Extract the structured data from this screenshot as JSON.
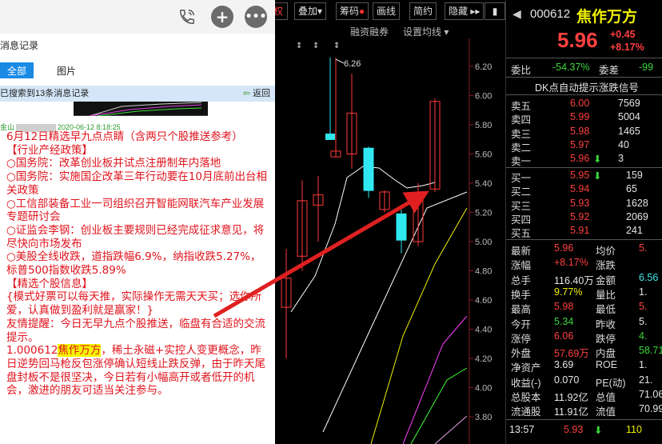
{
  "chat": {
    "history_title": "消息记录",
    "tabs": [
      "全部",
      "图片"
    ],
    "search_result": "已搜索到13条消息记录",
    "back_label": "返回",
    "meta_sender": "金山",
    "meta_time": "2020-06-12 8:18:25",
    "paragraphs": [
      "6月12日精选早九点点睛（含两只个股推送参考）",
      "【行业产经政策】",
      "○国务院：改革创业板并试点注册制年内落地",
      "○国务院：实施国企改革三年行动要在10月底前出台相关政策",
      "○工信部装备工业一司组织召开智能网联汽车产业发展专题研讨会",
      "○证监会李钢：创业板主要规则已经完成征求意见，将尽快向市场发布",
      "○美股全线收跌，道指跌幅6.9%，纳指收跌5.27%，标普500指数收跌5.89%",
      "【精选个股信息】",
      "{模式好票可以每天推，实际操作无需天天买；选你所爱，认真做到盈利就是赢家！}",
      "友情提醒：今日无早九点个股推送，临盘有合适的交流提示。"
    ],
    "stock_prefix": "1.000612",
    "stock_highlight": "焦作万方",
    "stock_rest": "，稀土永磁+实控人变更概念，昨日逆势回马枪反包涨停确认短线止跌反弹，由于昨天尾盘封板不是很坚决，今日若有小幅高开或者低开的机会，激进的朋友可适当关注参与。"
  },
  "toolbar": {
    "items": [
      "叠加",
      "筹码",
      "画线",
      "简约",
      "隐藏"
    ],
    "sub_items": [
      "融资融券",
      "设置均线"
    ]
  },
  "chart_data": {
    "type": "candlestick",
    "y_ticks": [
      "6.20",
      "6.00",
      "5.80",
      "5.60",
      "5.40",
      "5.20",
      "5.00",
      "4.80",
      "4.60",
      "4.40",
      "4.20",
      "4.00",
      "3.80"
    ],
    "ylim": [
      3.7,
      6.25
    ],
    "high_annotation": "6.26",
    "candles": [
      {
        "o": 4.55,
        "h": 4.95,
        "l": 4.2,
        "c": 4.75
      },
      {
        "o": 4.9,
        "h": 5.42,
        "l": 4.8,
        "c": 5.28
      },
      {
        "o": 5.25,
        "h": 5.45,
        "l": 5.0,
        "c": 5.32
      },
      {
        "o": 5.6,
        "h": 5.9,
        "l": 5.45,
        "c": 5.86
      },
      {
        "o": 5.62,
        "h": 6.26,
        "l": 5.58,
        "c": 5.58
      },
      {
        "o": 5.6,
        "h": 6.15,
        "l": 5.5,
        "c": 5.88
      },
      {
        "o": 5.64,
        "h": 5.65,
        "l": 5.3,
        "c": 5.35
      },
      {
        "o": 5.22,
        "h": 5.35,
        "l": 5.2,
        "c": 5.34
      },
      {
        "o": 5.19,
        "h": 5.22,
        "l": 4.92,
        "c": 5.01
      },
      {
        "o": 5.0,
        "h": 5.4,
        "l": 4.97,
        "c": 5.32
      },
      {
        "o": 5.4,
        "h": 5.5,
        "l": 4.97,
        "c": 5.4
      },
      {
        "o": 5.36,
        "h": 5.98,
        "l": 5.34,
        "c": 5.96
      }
    ],
    "ma_colors": [
      "#ffffff",
      "#f0f000",
      "#ff40ff",
      "#40ff40",
      "#e8a0e8"
    ]
  },
  "quote": {
    "code": "000612",
    "name": "焦作万方",
    "price": "5.96",
    "change": "+0.45",
    "change_pct": "+8.17%",
    "weibi_label": "委比",
    "weibi_value": "-54.37%",
    "weicha_label": "委差",
    "weicha_value": "-99",
    "dk_label": "DK点自动提示涨跌信号",
    "sells": [
      {
        "label": "卖五",
        "price": "6.00",
        "vol": "7569"
      },
      {
        "label": "卖四",
        "price": "5.99",
        "vol": "5004"
      },
      {
        "label": "卖三",
        "price": "5.98",
        "vol": "1465"
      },
      {
        "label": "卖二",
        "price": "5.97",
        "vol": "40"
      },
      {
        "label": "卖一",
        "price": "5.96",
        "vol": "3"
      }
    ],
    "buys": [
      {
        "label": "买一",
        "price": "5.95",
        "vol": "159"
      },
      {
        "label": "买二",
        "price": "5.94",
        "vol": "65"
      },
      {
        "label": "买三",
        "price": "5.93",
        "vol": "1628"
      },
      {
        "label": "买四",
        "price": "5.92",
        "vol": "2069"
      },
      {
        "label": "买五",
        "price": "5.91",
        "vol": "241"
      }
    ],
    "stats": [
      {
        "l1": "最新",
        "v1": "5.96",
        "c1": "red",
        "l2": "均价",
        "v2": "5.",
        "c2": "red"
      },
      {
        "l1": "涨幅",
        "v1": "+8.17%",
        "c1": "red",
        "l2": "涨跌",
        "v2": "",
        "c2": "red"
      },
      {
        "l1": "总手",
        "v1": "116.40万",
        "c1": "wht",
        "l2": "金额",
        "v2": "6.56",
        "c2": "cyan"
      },
      {
        "l1": "换手",
        "v1": "9.77%",
        "c1": "yel",
        "l2": "量比",
        "v2": "1.",
        "c2": "wht"
      },
      {
        "l1": "最高",
        "v1": "5.98",
        "c1": "red",
        "l2": "最低",
        "v2": "5.",
        "c2": "red"
      },
      {
        "l1": "今开",
        "v1": "5.34",
        "c1": "grn",
        "l2": "昨收",
        "v2": "5.",
        "c2": "wht"
      },
      {
        "l1": "涨停",
        "v1": "6.06",
        "c1": "red",
        "l2": "跌停",
        "v2": "4.",
        "c2": "grn"
      },
      {
        "l1": "外盘",
        "v1": "57.69万",
        "c1": "red",
        "l2": "内盘",
        "v2": "58.71",
        "c2": "grn"
      },
      {
        "l1": "净资产",
        "v1": "3.69",
        "c1": "wht",
        "l2": "ROE",
        "v2": "1.",
        "c2": "wht"
      },
      {
        "l1": "收益(-)",
        "v1": "0.070",
        "c1": "wht",
        "l2": "PE(动)",
        "v2": "21.",
        "c2": "wht"
      },
      {
        "l1": "总股本",
        "v1": "11.92亿",
        "c1": "wht",
        "l2": "总值",
        "v2": "71.06",
        "c2": "wht"
      },
      {
        "l1": "流通股",
        "v1": "11.91亿",
        "c1": "wht",
        "l2": "流值",
        "v2": "70.99",
        "c2": "wht"
      }
    ],
    "tick": {
      "time": "13:57",
      "price": "5.93",
      "vol": "110"
    }
  }
}
